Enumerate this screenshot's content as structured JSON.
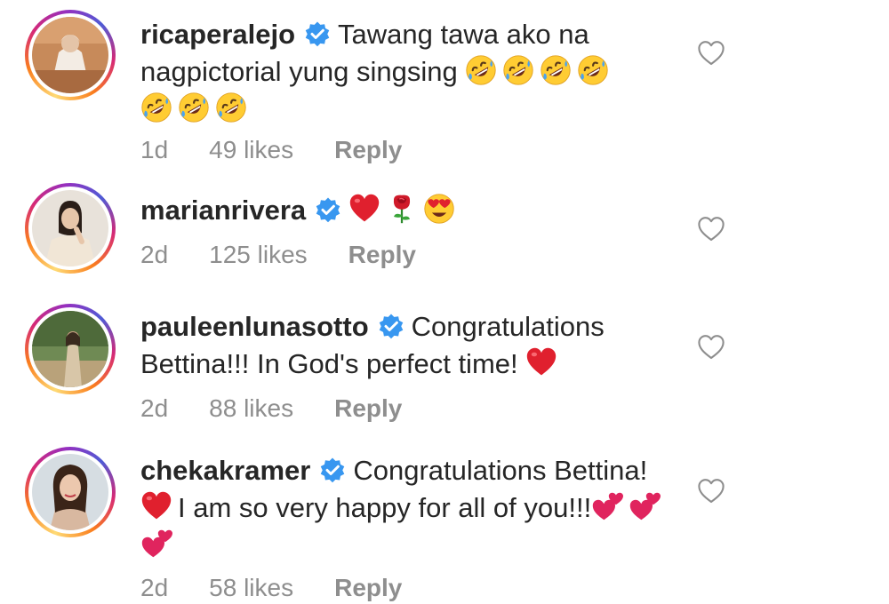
{
  "comments": [
    {
      "username": "ricaperalejo",
      "text": "Tawang tawa ako na nagpictorial yung singsing",
      "emojis": [
        "rofl",
        "rofl",
        "rofl",
        "rofl",
        "rofl",
        "rofl",
        "rofl"
      ],
      "time": "1d",
      "likes": "49 likes",
      "reply": "Reply"
    },
    {
      "username": "marianrivera",
      "text": "",
      "emojis": [
        "red-heart",
        "rose",
        "heart-eyes"
      ],
      "time": "2d",
      "likes": "125 likes",
      "reply": "Reply"
    },
    {
      "username": "pauleenlunasotto",
      "text": "Congratulations Bettina!!! In God's perfect time!",
      "emojis": [
        "red-heart"
      ],
      "time": "2d",
      "likes": "88 likes",
      "reply": "Reply"
    },
    {
      "username": "chekakramer",
      "text_a": "Congratulations Bettina!",
      "text_b": "I am so very happy for all of you!!!",
      "emojis": [
        "red-heart",
        "two-hearts",
        "two-hearts",
        "two-hearts"
      ],
      "time": "2d",
      "likes": "58 likes",
      "reply": "Reply"
    }
  ],
  "colors": {
    "text": "#262626",
    "meta": "#8e8e8e",
    "verified": "#3897f0",
    "heart": "#e0202e"
  }
}
